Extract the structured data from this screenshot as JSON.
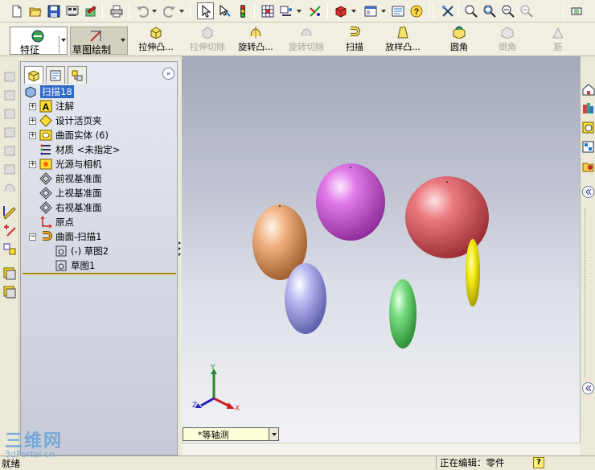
{
  "toolbar": {
    "icons": [
      "new-document-icon",
      "open-folder-icon",
      "save-icon",
      "print-options-icon",
      "rebuild-icon",
      "print-icon",
      "undo-icon",
      "redo-icon",
      "select-pointer-icon",
      "select-other-icon",
      "traffic-light-icon",
      "grid-icon",
      "sketch-relations-icon",
      "smart-dimension-icon",
      "appearance-icon",
      "view-orientation-icon",
      "help-icon",
      "tools-icon",
      "zoom-fit-icon",
      "zoom-area-icon",
      "zoom-in-out-icon",
      "zoom-selection-icon",
      "options-icon"
    ]
  },
  "command_manager": {
    "tabs": [
      {
        "label": "特征",
        "active": true
      },
      {
        "label": "草图绘制",
        "active": false
      }
    ],
    "buttons": [
      {
        "label": "拉伸凸...",
        "enabled": true
      },
      {
        "label": "拉伸切除",
        "enabled": false
      },
      {
        "label": "旋转凸...",
        "enabled": true
      },
      {
        "label": "旋转切除",
        "enabled": false
      },
      {
        "label": "扫描",
        "enabled": true
      },
      {
        "label": "放样凸...",
        "enabled": true
      },
      {
        "label": "圆角",
        "enabled": true
      },
      {
        "label": "倒角",
        "enabled": false
      },
      {
        "label": "筋",
        "enabled": false
      }
    ]
  },
  "feature_tree": {
    "root": "扫描18",
    "items": [
      {
        "label": "注解",
        "icon": "annotation-icon",
        "expandable": true
      },
      {
        "label": "设计活页夹",
        "icon": "design-binder-icon",
        "expandable": true
      },
      {
        "label": "曲面实体 (6)",
        "icon": "surface-bodies-icon",
        "expandable": true
      },
      {
        "label": "材质 <未指定>",
        "icon": "material-icon",
        "expandable": false
      },
      {
        "label": "光源与相机",
        "icon": "lights-cameras-icon",
        "expandable": true
      },
      {
        "label": "前视基准面",
        "icon": "plane-icon",
        "expandable": false
      },
      {
        "label": "上视基准面",
        "icon": "plane-icon",
        "expandable": false
      },
      {
        "label": "右视基准面",
        "icon": "plane-icon",
        "expandable": false
      },
      {
        "label": "原点",
        "icon": "origin-icon",
        "expandable": false
      },
      {
        "label": "曲面-扫描1",
        "icon": "surface-sweep-icon",
        "expandable": true,
        "expanded": true
      },
      {
        "label": "(-) 草图2",
        "icon": "sketch-icon",
        "child": true
      },
      {
        "label": "草图1",
        "icon": "sketch-icon",
        "child": true
      }
    ]
  },
  "viewport": {
    "view_orientation": "*等轴测",
    "triad_labels": {
      "x": "X",
      "y": "Y",
      "z": "Z"
    },
    "bodies": [
      {
        "name": "orange-ellipsoid",
        "color": "#e8a06a"
      },
      {
        "name": "magenta-sphere",
        "color": "#d468e0"
      },
      {
        "name": "red-sphere",
        "color": "#e46a72"
      },
      {
        "name": "lavender-ellipsoid",
        "color": "#a8a8ec"
      },
      {
        "name": "green-ellipsoid",
        "color": "#6ed878"
      },
      {
        "name": "yellow-disc",
        "color": "#f0e800"
      }
    ]
  },
  "statusbar": {
    "left": "就绪",
    "editing": "正在编辑：零件",
    "help": "?"
  },
  "watermark": {
    "big": "三维网",
    "small": "3dPortal.cn"
  }
}
